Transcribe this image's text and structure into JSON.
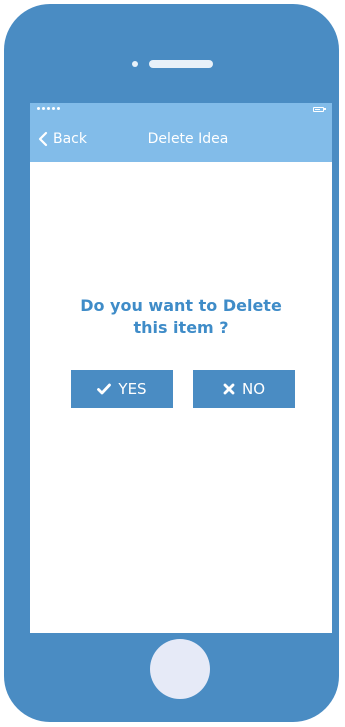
{
  "navbar": {
    "back_label": "Back",
    "title": "Delete Idea"
  },
  "dialog": {
    "prompt_line1": "Do you want to Delete",
    "prompt_line2": "this item ?",
    "yes_label": "YES",
    "no_label": "NO"
  },
  "icons": {
    "back": "chevron-left-icon",
    "yes": "check-icon",
    "no": "close-icon",
    "signal": "signal-dots-icon",
    "battery": "battery-icon"
  },
  "colors": {
    "phone_body": "#4a8cc3",
    "navbar": "#82bce9",
    "prompt_text": "#3f8cc8",
    "button": "#4a8cc3",
    "home_button": "#e6eaf7"
  }
}
